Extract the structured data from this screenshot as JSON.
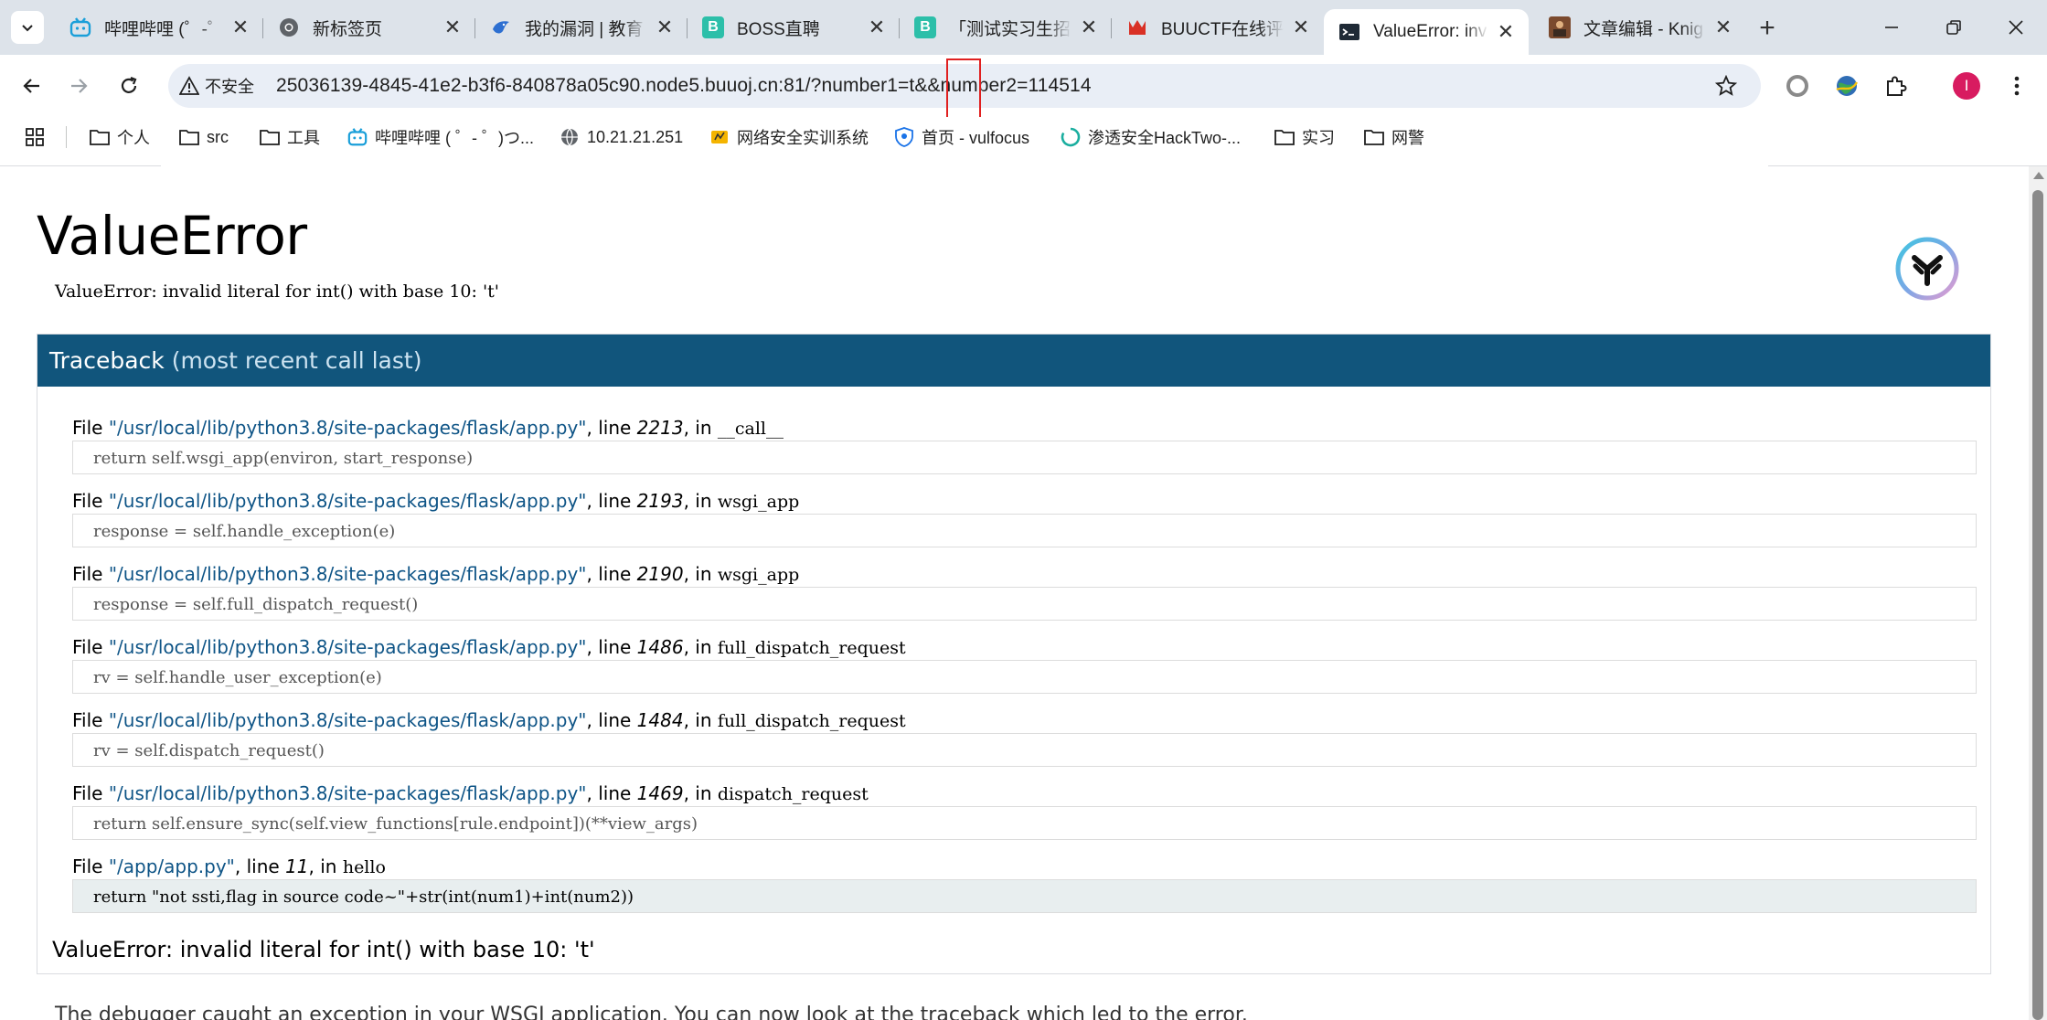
{
  "browser": {
    "tabs": [
      {
        "title": "哔哩哔哩 (゜-゜)つ",
        "icon": "bilibili-icon",
        "active": false
      },
      {
        "title": "新标签页",
        "icon": "chrome-icon",
        "active": false
      },
      {
        "title": "我的漏洞 | 教育",
        "icon": "bird-icon",
        "active": false
      },
      {
        "title": "BOSS直聘",
        "icon": "boss-icon",
        "active": false
      },
      {
        "title": "「测试实习生招",
        "icon": "boss-icon",
        "active": false
      },
      {
        "title": "BUUCTF在线评",
        "icon": "buuctf-icon",
        "active": false
      },
      {
        "title": "ValueError: inv",
        "icon": "terminal-icon",
        "active": true
      },
      {
        "title": "文章编辑 - Knig",
        "icon": "image-icon",
        "active": false
      }
    ],
    "tab_close_glyph": "✕",
    "new_tab_glyph": "+",
    "security_label": "不安全",
    "url": "25036139-4845-41e2-b3f6-840878a05c90.node5.buuoj.cn:81/?number1=t&&number2=114514",
    "profile_initial": "I",
    "bookmarks": [
      {
        "label": "个人",
        "icon": "folder-icon"
      },
      {
        "label": "src",
        "icon": "folder-icon"
      },
      {
        "label": "工具",
        "icon": "folder-icon"
      },
      {
        "label": "哔哩哔哩 ( ゜- ゜)つ...",
        "icon": "bilibili-icon"
      },
      {
        "label": "10.21.21.251",
        "icon": "globe-icon"
      },
      {
        "label": "网络安全实训系统",
        "icon": "training-icon"
      },
      {
        "label": "首页 - vulfocus",
        "icon": "shield-icon"
      },
      {
        "label": "渗透安全HackTwo-...",
        "icon": "loading-icon"
      },
      {
        "label": "实习",
        "icon": "folder-icon"
      },
      {
        "label": "网警",
        "icon": "folder-icon"
      }
    ],
    "colors": {
      "tabstrip": "#dde3ea",
      "omnibox": "#e9eef6",
      "highlight_box": "#e02020"
    }
  },
  "page": {
    "title": "ValueError",
    "message": "ValueError: invalid literal for int() with base 10: 't'",
    "traceback_title": "Traceback",
    "traceback_subtitle": "(most recent call last)",
    "frames": [
      {
        "file": "\"/usr/local/lib/python3.8/site-packages/flask/app.py\"",
        "line": "2213",
        "func": "__call__",
        "code": "return self.wsgi_app(environ, start_response)",
        "app": false
      },
      {
        "file": "\"/usr/local/lib/python3.8/site-packages/flask/app.py\"",
        "line": "2193",
        "func": "wsgi_app",
        "code": "response = self.handle_exception(e)",
        "app": false
      },
      {
        "file": "\"/usr/local/lib/python3.8/site-packages/flask/app.py\"",
        "line": "2190",
        "func": "wsgi_app",
        "code": "response = self.full_dispatch_request()",
        "app": false
      },
      {
        "file": "\"/usr/local/lib/python3.8/site-packages/flask/app.py\"",
        "line": "1486",
        "func": "full_dispatch_request",
        "code": "rv = self.handle_user_exception(e)",
        "app": false
      },
      {
        "file": "\"/usr/local/lib/python3.8/site-packages/flask/app.py\"",
        "line": "1484",
        "func": "full_dispatch_request",
        "code": "rv = self.dispatch_request()",
        "app": false
      },
      {
        "file": "\"/usr/local/lib/python3.8/site-packages/flask/app.py\"",
        "line": "1469",
        "func": "dispatch_request",
        "code": "return self.ensure_sync(self.view_functions[rule.endpoint])(**view_args)",
        "app": false
      },
      {
        "file": "\"/app/app.py\"",
        "line": "11",
        "func": "hello",
        "code": "return \"not ssti,flag in source code~\"+str(int(num1)+int(num2))",
        "app": true
      }
    ],
    "file_word": "File",
    "line_word": ", line",
    "in_word": ", in",
    "final_message": "ValueError: invalid literal for int() with base 10: 't'",
    "explanation": "The debugger caught an exception in your WSGI application. You can now look at the traceback which led to the error.",
    "colors": {
      "traceback_header": "#11557c",
      "file_link": "#0e5486",
      "app_frame_bg": "#e8eeef"
    }
  }
}
